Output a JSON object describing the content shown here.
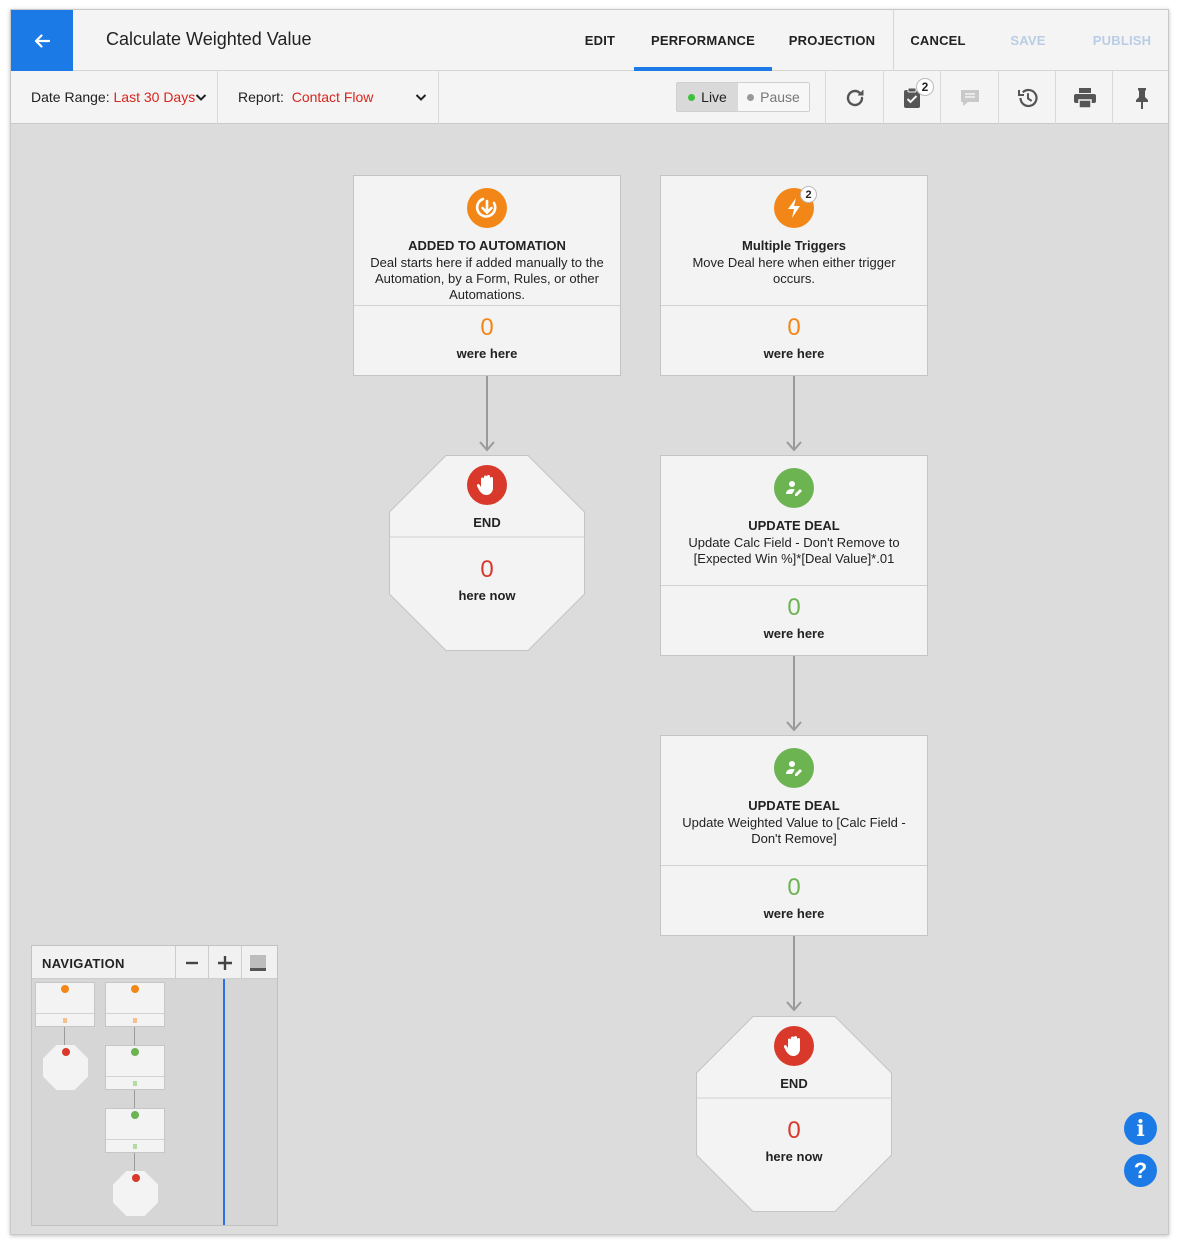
{
  "header": {
    "title": "Calculate Weighted Value",
    "tabs": [
      {
        "label": "EDIT"
      },
      {
        "label": "PERFORMANCE"
      },
      {
        "label": "PROJECTION"
      }
    ],
    "cancel_label": "CANCEL",
    "save_label": "SAVE",
    "publish_label": "PUBLISH",
    "accent_color": "#1b7ae6"
  },
  "toolbar": {
    "date_range_label": "Date Range:",
    "date_range_value": "Last 30 Days",
    "report_label": "Report:",
    "report_value": "Contact Flow",
    "live_label": "Live",
    "pause_label": "Pause",
    "tasks_badge": "2",
    "icons": [
      "refresh-icon",
      "tasks-icon",
      "notes-icon",
      "history-icon",
      "print-icon",
      "pin-icon"
    ]
  },
  "flow": {
    "added": {
      "title": "ADDED TO AUTOMATION",
      "desc": "Deal starts here if added manually to the Automation, by a Form, Rules, or other Automations.",
      "count": "0",
      "count_label": "were here"
    },
    "triggers": {
      "title": "Multiple Triggers",
      "desc": "Move Deal here when either trigger occurs.",
      "badge": "2",
      "count": "0",
      "count_label": "were here"
    },
    "end1": {
      "title": "END",
      "count": "0",
      "count_label": "here now"
    },
    "update1": {
      "title": "UPDATE DEAL",
      "desc": "Update Calc Field - Don't Remove to [Expected Win %]*[Deal Value]*.01",
      "count": "0",
      "count_label": "were here"
    },
    "update2": {
      "title": "UPDATE DEAL",
      "desc": "Update Weighted Value to [Calc Field - Don't Remove]",
      "count": "0",
      "count_label": "were here"
    },
    "end2": {
      "title": "END",
      "count": "0",
      "count_label": "here now"
    },
    "colors": {
      "orange": "#f28718",
      "green": "#6cb351",
      "red": "#d8392b"
    }
  },
  "navigation": {
    "title": "NAVIGATION"
  }
}
